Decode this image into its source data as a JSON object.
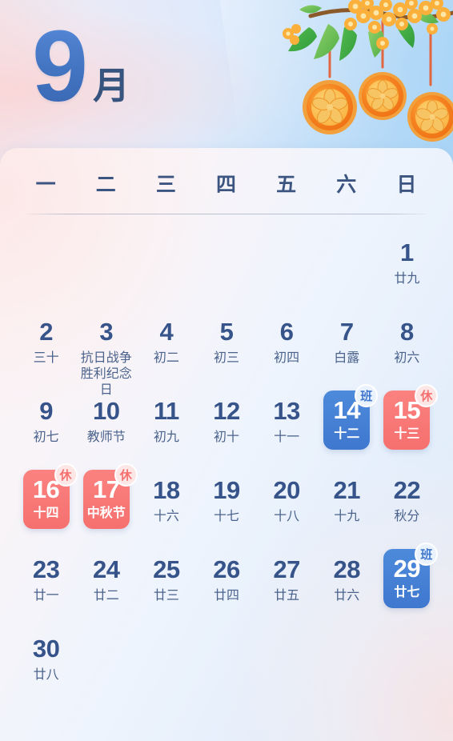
{
  "header": {
    "month_number": "9",
    "month_unit": "月",
    "decoration": {
      "name": "osmanthus-mooncake-illustration",
      "sky_color": "#a9d4f6",
      "flower_color": "#f9a22b",
      "leaf_color": "#3fae4a",
      "mooncake_color": "#f47b20"
    }
  },
  "weekdays": [
    {
      "label": "一"
    },
    {
      "label": "二"
    },
    {
      "label": "三"
    },
    {
      "label": "四"
    },
    {
      "label": "五"
    },
    {
      "label": "六"
    },
    {
      "label": "日"
    }
  ],
  "colors": {
    "work_blue": "#3f78cf",
    "rest_red": "#f5706f",
    "text_navy": "#37548a",
    "lunar_text": "#4b638c"
  },
  "legend": {
    "work_badge": "班",
    "rest_badge": "休"
  },
  "days": [
    {
      "num": "",
      "lunar": "",
      "type": "empty"
    },
    {
      "num": "",
      "lunar": "",
      "type": "empty"
    },
    {
      "num": "",
      "lunar": "",
      "type": "empty"
    },
    {
      "num": "",
      "lunar": "",
      "type": "empty"
    },
    {
      "num": "",
      "lunar": "",
      "type": "empty"
    },
    {
      "num": "",
      "lunar": "",
      "type": "empty"
    },
    {
      "num": "1",
      "lunar": "廿九",
      "type": "normal"
    },
    {
      "num": "2",
      "lunar": "三十",
      "type": "normal"
    },
    {
      "num": "3",
      "lunar": "抗日战争胜利纪念日",
      "type": "normal",
      "two_line": true
    },
    {
      "num": "4",
      "lunar": "初二",
      "type": "normal"
    },
    {
      "num": "5",
      "lunar": "初三",
      "type": "normal"
    },
    {
      "num": "6",
      "lunar": "初四",
      "type": "normal"
    },
    {
      "num": "7",
      "lunar": "白露",
      "type": "normal"
    },
    {
      "num": "8",
      "lunar": "初六",
      "type": "normal"
    },
    {
      "num": "9",
      "lunar": "初七",
      "type": "normal"
    },
    {
      "num": "10",
      "lunar": "教师节",
      "type": "normal"
    },
    {
      "num": "11",
      "lunar": "初九",
      "type": "normal"
    },
    {
      "num": "12",
      "lunar": "初十",
      "type": "normal"
    },
    {
      "num": "13",
      "lunar": "十一",
      "type": "normal"
    },
    {
      "num": "14",
      "lunar": "十二",
      "type": "work",
      "badge": "班"
    },
    {
      "num": "15",
      "lunar": "十三",
      "type": "rest",
      "badge": "休"
    },
    {
      "num": "16",
      "lunar": "十四",
      "type": "rest",
      "badge": "休"
    },
    {
      "num": "17",
      "lunar": "中秋节",
      "type": "rest",
      "badge": "休"
    },
    {
      "num": "18",
      "lunar": "十六",
      "type": "normal"
    },
    {
      "num": "19",
      "lunar": "十七",
      "type": "normal"
    },
    {
      "num": "20",
      "lunar": "十八",
      "type": "normal"
    },
    {
      "num": "21",
      "lunar": "十九",
      "type": "normal"
    },
    {
      "num": "22",
      "lunar": "秋分",
      "type": "normal"
    },
    {
      "num": "23",
      "lunar": "廿一",
      "type": "normal"
    },
    {
      "num": "24",
      "lunar": "廿二",
      "type": "normal"
    },
    {
      "num": "25",
      "lunar": "廿三",
      "type": "normal"
    },
    {
      "num": "26",
      "lunar": "廿四",
      "type": "normal"
    },
    {
      "num": "27",
      "lunar": "廿五",
      "type": "normal"
    },
    {
      "num": "28",
      "lunar": "廿六",
      "type": "normal"
    },
    {
      "num": "29",
      "lunar": "廿七",
      "type": "work",
      "badge": "班"
    },
    {
      "num": "30",
      "lunar": "廿八",
      "type": "normal"
    },
    {
      "num": "",
      "lunar": "",
      "type": "empty"
    },
    {
      "num": "",
      "lunar": "",
      "type": "empty"
    },
    {
      "num": "",
      "lunar": "",
      "type": "empty"
    },
    {
      "num": "",
      "lunar": "",
      "type": "empty"
    },
    {
      "num": "",
      "lunar": "",
      "type": "empty"
    },
    {
      "num": "",
      "lunar": "",
      "type": "empty"
    }
  ]
}
